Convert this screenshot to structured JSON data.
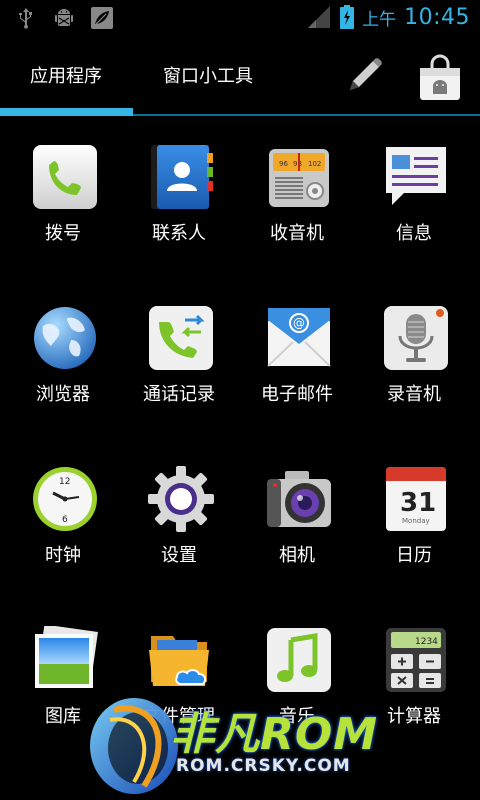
{
  "status_bar": {
    "icons": [
      "usb-icon",
      "android-debug-icon",
      "leaf-notification-icon"
    ],
    "ampm": "上午",
    "time": "10:45",
    "accent": "#33b5e5"
  },
  "tabs": [
    {
      "label": "应用程序",
      "selected": true
    },
    {
      "label": "窗口小工具",
      "selected": false
    }
  ],
  "toolbar_icons": [
    "pencil-icon",
    "market-bag-icon"
  ],
  "apps": [
    {
      "label": "拨号",
      "icon": "phone-icon"
    },
    {
      "label": "联系人",
      "icon": "contacts-icon"
    },
    {
      "label": "收音机",
      "icon": "radio-icon"
    },
    {
      "label": "信息",
      "icon": "messaging-icon"
    },
    {
      "label": "浏览器",
      "icon": "globe-icon"
    },
    {
      "label": "通话记录",
      "icon": "call-log-icon"
    },
    {
      "label": "电子邮件",
      "icon": "email-icon"
    },
    {
      "label": "录音机",
      "icon": "microphone-icon"
    },
    {
      "label": "时钟",
      "icon": "clock-icon"
    },
    {
      "label": "设置",
      "icon": "gear-icon"
    },
    {
      "label": "相机",
      "icon": "camera-icon"
    },
    {
      "label": "日历",
      "icon": "calendar-icon"
    },
    {
      "label": "图库",
      "icon": "gallery-icon"
    },
    {
      "label": "文件管理",
      "icon": "file-manager-icon"
    },
    {
      "label": "音乐",
      "icon": "music-icon"
    },
    {
      "label": "计算器",
      "icon": "calculator-icon"
    }
  ],
  "radio_dial": [
    "96",
    "98",
    "102"
  ],
  "calendar_icon": {
    "day": "31",
    "weekday": "Monday"
  },
  "clock_icon": {
    "top": "12",
    "bottom": "6"
  },
  "calculator_display": "1234",
  "watermark": {
    "brand": "非凡ROM",
    "site": "ROM.CRSKY.COM"
  }
}
